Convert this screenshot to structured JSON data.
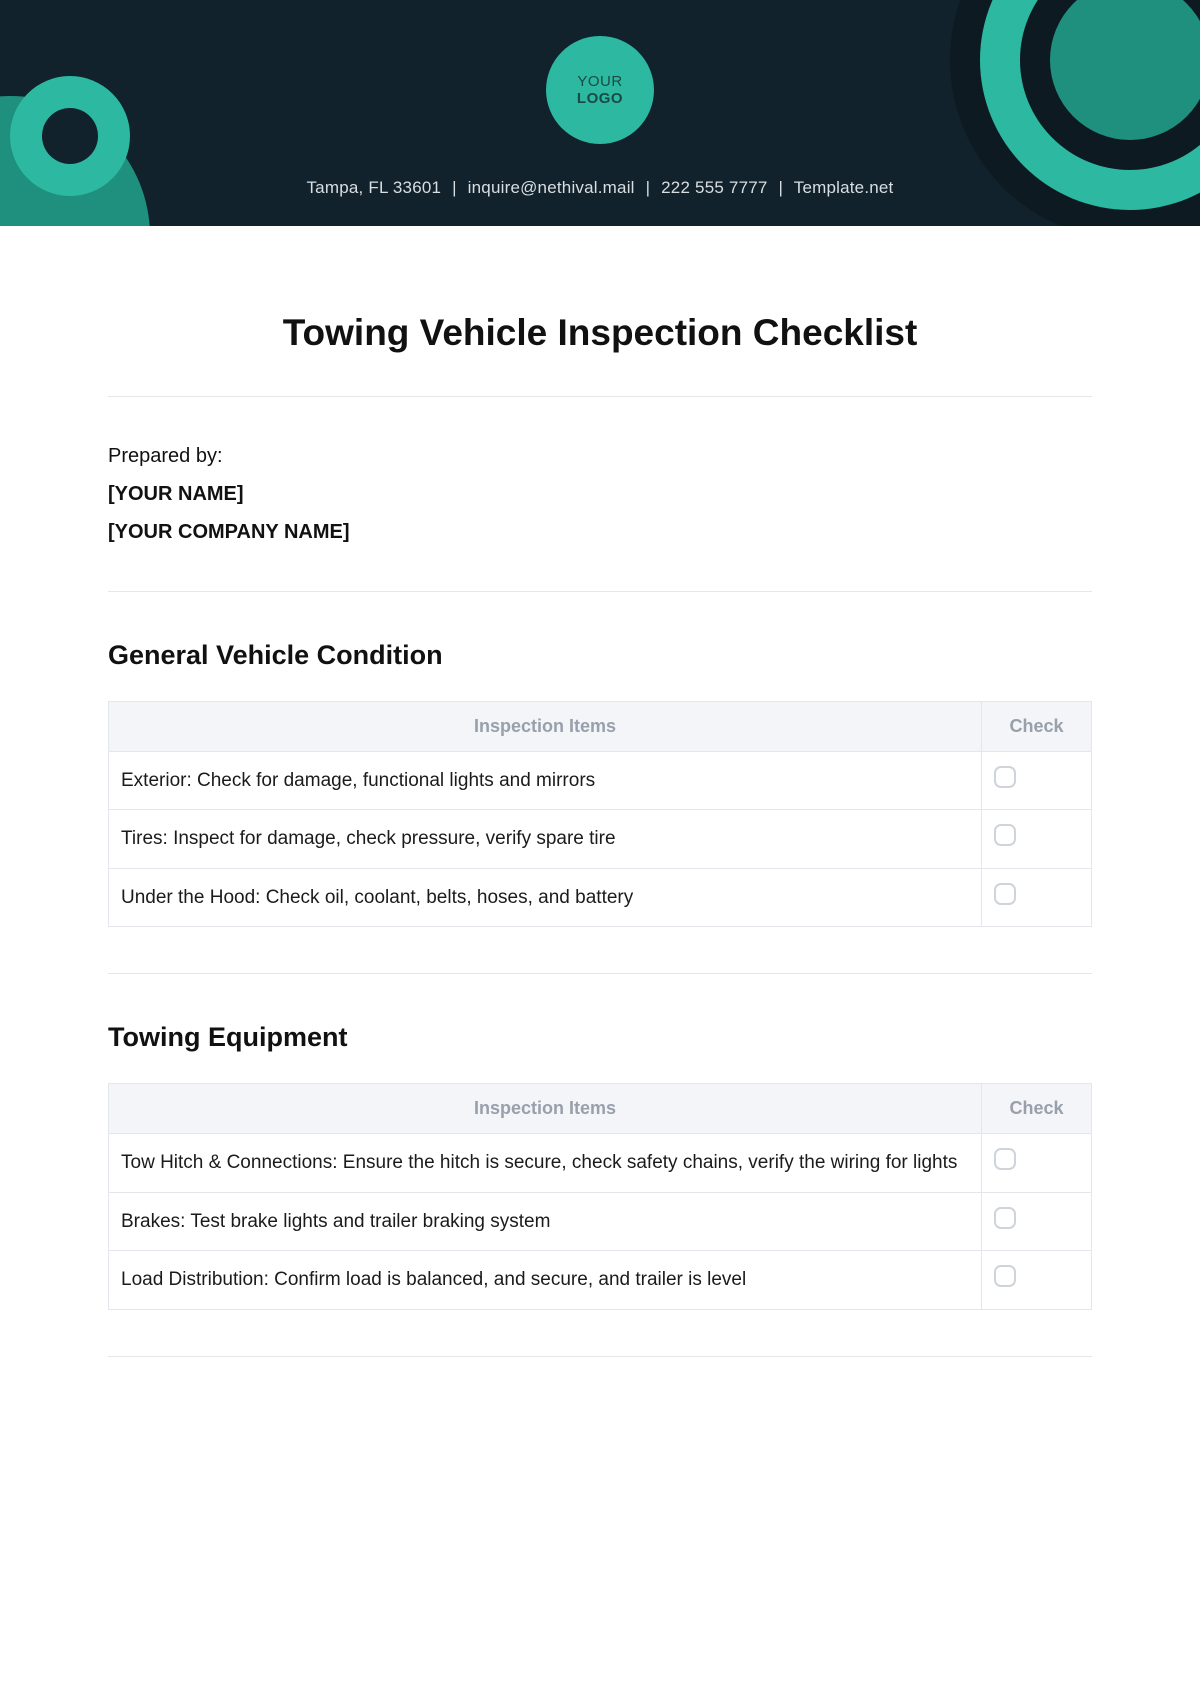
{
  "header": {
    "logo_line1": "YOUR",
    "logo_line2": "LOGO",
    "contact_city": "Tampa, FL 33601",
    "contact_email": "inquire@nethival.mail",
    "contact_phone": "222 555 7777",
    "contact_site": "Template.net"
  },
  "title": "Towing Vehicle Inspection Checklist",
  "prepared": {
    "label": "Prepared by:",
    "name": "[YOUR NAME]",
    "company": "[YOUR COMPANY NAME]"
  },
  "table_headers": {
    "items": "Inspection Items",
    "check": "Check"
  },
  "sections": [
    {
      "heading": "General Vehicle Condition",
      "rows": [
        "Exterior: Check for damage, functional lights and mirrors",
        "Tires: Inspect for damage, check pressure, verify spare tire",
        "Under the Hood: Check oil, coolant, belts, hoses, and battery"
      ]
    },
    {
      "heading": "Towing Equipment",
      "rows": [
        "Tow Hitch & Connections: Ensure the hitch is secure, check safety chains, verify the wiring for lights",
        "Brakes: Test brake lights and trailer braking system",
        "Load Distribution: Confirm load is balanced, and secure, and trailer is level"
      ]
    }
  ]
}
